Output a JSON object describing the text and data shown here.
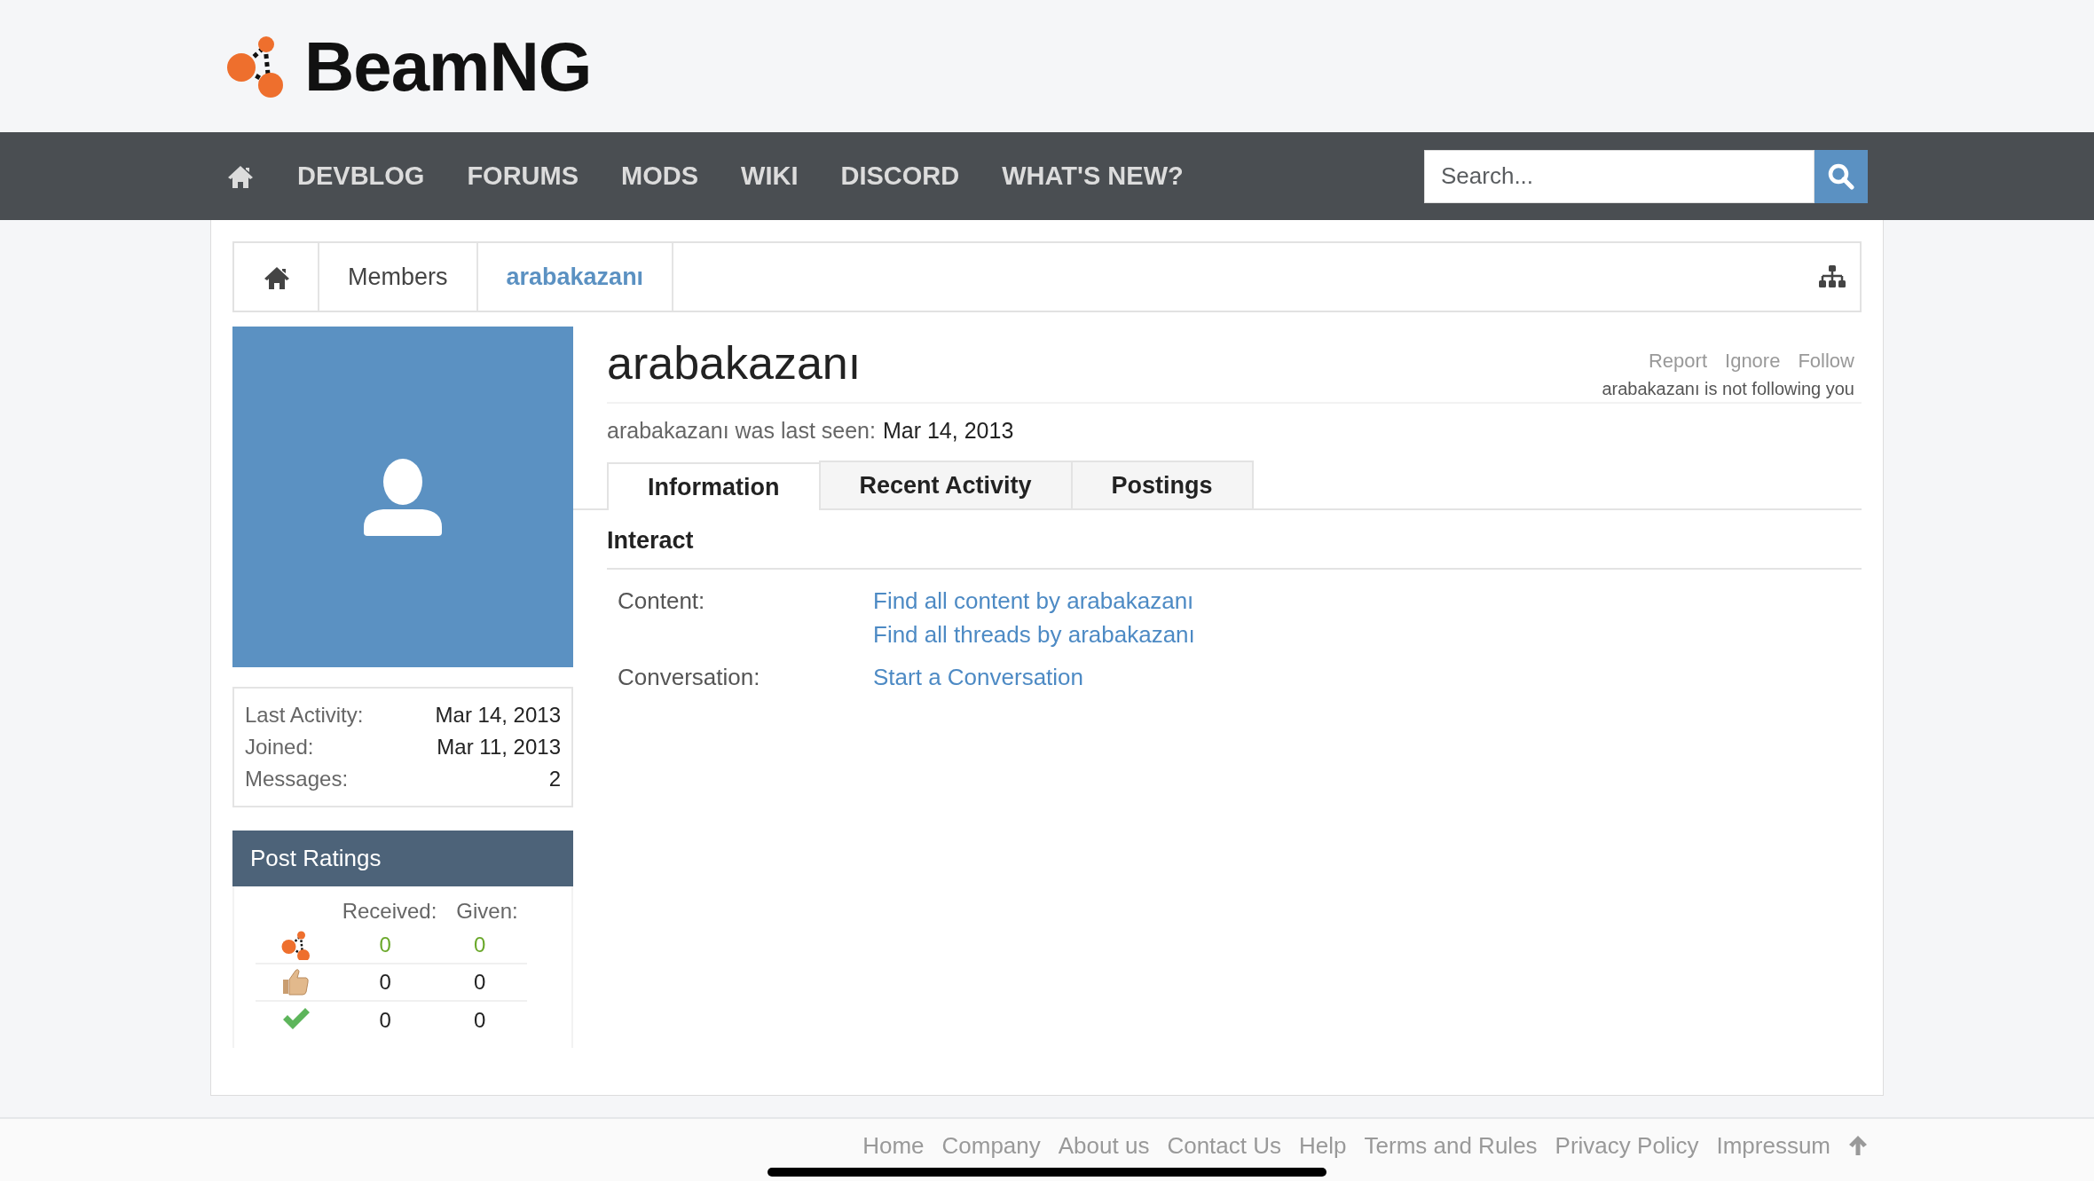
{
  "logo": {
    "text": "BeamNG"
  },
  "nav": {
    "items": [
      {
        "kind": "home"
      },
      {
        "kind": "link",
        "label": "DEVBLOG"
      },
      {
        "kind": "link",
        "label": "FORUMS"
      },
      {
        "kind": "link",
        "label": "MODS"
      },
      {
        "kind": "link",
        "label": "WIKI"
      },
      {
        "kind": "link",
        "label": "DISCORD"
      },
      {
        "kind": "link",
        "label": "WHAT'S NEW?"
      }
    ]
  },
  "search": {
    "placeholder": "Search..."
  },
  "breadcrumb": [
    {
      "kind": "home",
      "selected": false
    },
    {
      "kind": "link",
      "label": "Members",
      "selected": false
    },
    {
      "kind": "link",
      "label": "arabakazanı",
      "selected": true
    }
  ],
  "stats": [
    {
      "label": "Last Activity:",
      "value": "Mar 14, 2013"
    },
    {
      "label": "Joined:",
      "value": "Mar 11, 2013"
    },
    {
      "label": "Messages:",
      "value": "2"
    }
  ],
  "post_ratings": {
    "title": "Post Ratings",
    "columns": [
      "Received:",
      "Given:"
    ],
    "rows": [
      {
        "kind": "beamng",
        "received": "0",
        "given": "0",
        "highlight": true
      },
      {
        "kind": "like",
        "received": "0",
        "given": "0",
        "highlight": false
      },
      {
        "kind": "agree",
        "received": "0",
        "given": "0",
        "highlight": false
      }
    ]
  },
  "profile": {
    "name": "arabakazanı",
    "actions": [
      "Report",
      "Ignore",
      "Follow"
    ],
    "follow_status": "arabakazanı is not following you",
    "last_seen_label": "arabakazanı was last seen:",
    "last_seen": "Mar 14, 2013"
  },
  "tabs": [
    {
      "label": "Information",
      "selected": true
    },
    {
      "label": "Recent Activity",
      "selected": false
    },
    {
      "label": "Postings",
      "selected": false
    }
  ],
  "section_title": "Interact",
  "interact": [
    {
      "label": "Content:",
      "links": [
        "Find all content by arabakazanı",
        "Find all threads by arabakazanı"
      ]
    },
    {
      "label": "Conversation:",
      "links": [
        "Start a Conversation"
      ]
    }
  ],
  "footer": {
    "links": [
      "Home",
      "Company",
      "About us",
      "Contact Us",
      "Help",
      "Terms and Rules",
      "Privacy Policy",
      "Impressum"
    ]
  }
}
